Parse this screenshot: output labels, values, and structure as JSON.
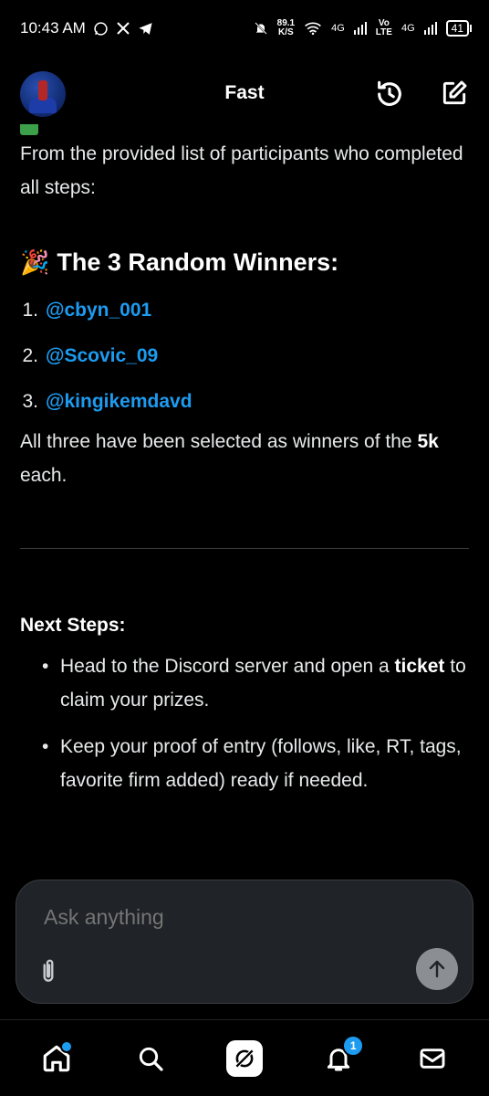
{
  "status_bar": {
    "time": "10:43 AM",
    "net_speed_value": "89.1",
    "net_speed_unit": "K/S",
    "network_1": "4G",
    "network_vo": "Vo",
    "network_lte": "LTE",
    "network_2": "4G",
    "battery": "41"
  },
  "header": {
    "title": "Fast"
  },
  "content": {
    "intro": "From the provided list of participants who completed all steps:",
    "winners_emoji": "🎉",
    "winners_heading": "The 3 Random Winners:",
    "winners": [
      {
        "num": "1.",
        "handle": "@cbyn_001"
      },
      {
        "num": "2.",
        "handle": "@Scovic_09"
      },
      {
        "num": "3.",
        "handle": "@kingikemdavd"
      }
    ],
    "selected_pre": "All three have been selected as winners of the ",
    "selected_bold": "5k",
    "selected_post": " each.",
    "next_steps_heading": "Next Steps:",
    "step1_pre": "Head to the Discord server and open a ",
    "step1_bold": "ticket",
    "step1_post": " to claim your prizes.",
    "step2": "Keep your proof of entry (follows, like, RT, tags, favorite firm added) ready if needed."
  },
  "composer": {
    "placeholder": "Ask anything"
  },
  "bottom_nav": {
    "notifications_badge": "1"
  },
  "colors": {
    "accent": "#1d9bf0",
    "background": "#000000",
    "composer_bg": "#202327"
  }
}
